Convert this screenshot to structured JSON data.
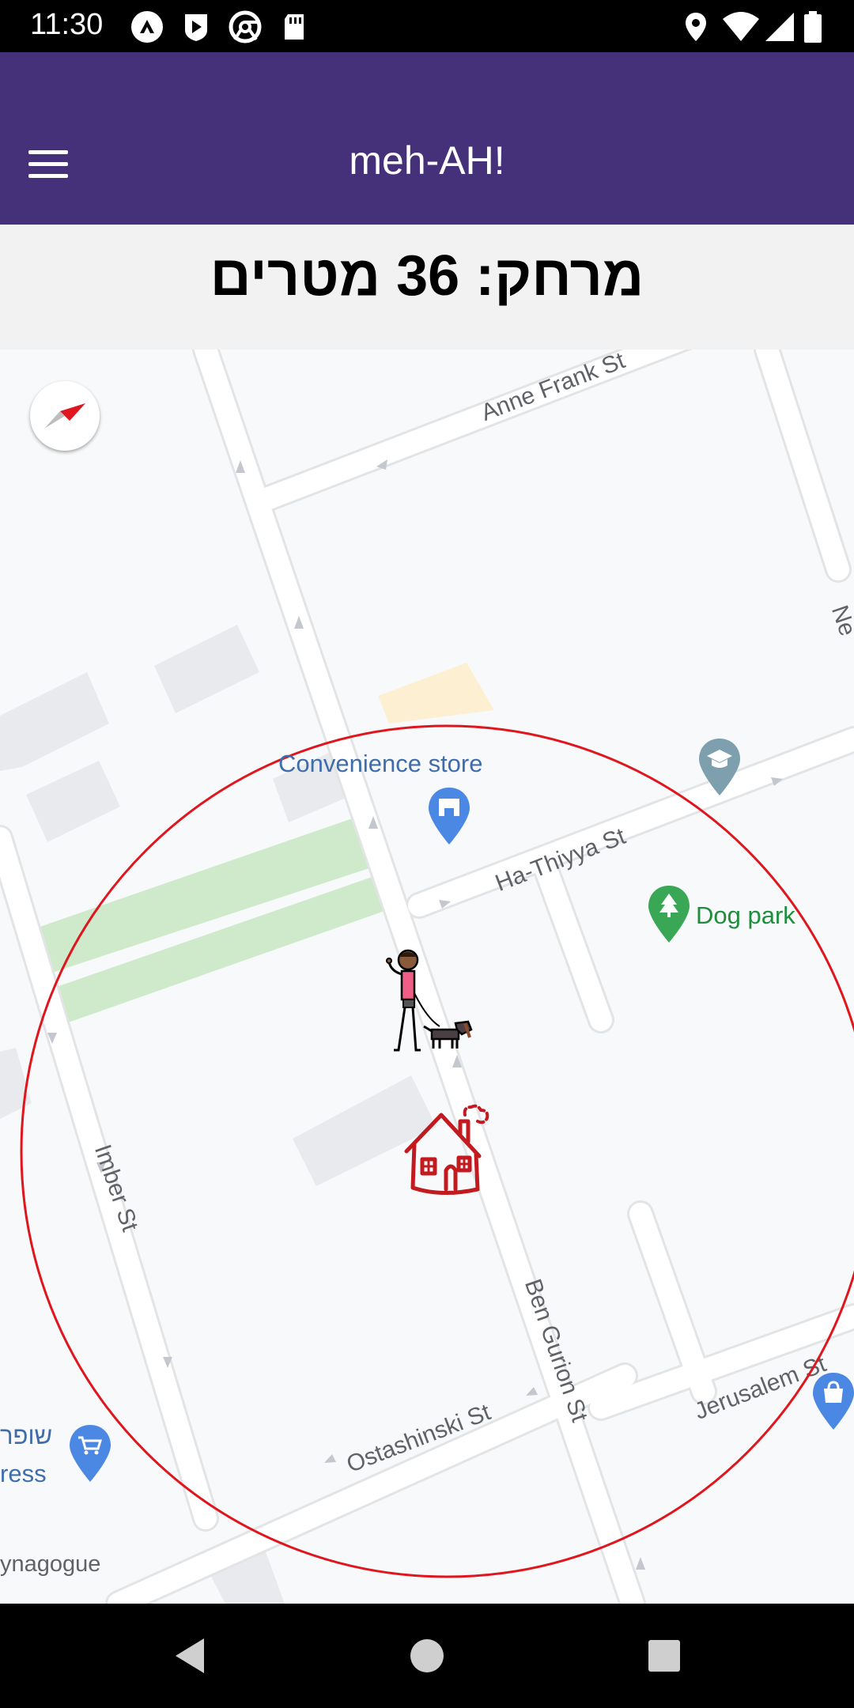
{
  "status_bar": {
    "time": "11:30",
    "left_icons": [
      "nearby-icon",
      "play-icon",
      "chrome-icon",
      "sd-card-icon"
    ],
    "right_icons": [
      "location-icon",
      "wifi-icon",
      "signal-icon",
      "battery-icon"
    ]
  },
  "app_bar": {
    "title": "meh-AH!",
    "menu_icon": "hamburger-menu-icon",
    "background": "#45307a"
  },
  "distance": {
    "text": "מרחק: 36 מטרים"
  },
  "map": {
    "streets": [
      "Anne Frank St",
      "Ha-Thiyya St",
      "Imber St",
      "Ben Gurion St",
      "Ostashinski St",
      "Jerusalem St",
      "Ne"
    ],
    "pois": {
      "convenience_store": "Convenience store",
      "dog_park": "Dog park",
      "supermarket_partial_he": "שופר",
      "supermarket_partial_en": "ress",
      "synagogue_partial": "ynagogue"
    },
    "circle_color": "#e0161e",
    "markers": [
      "person-with-dog-icon",
      "home-icon"
    ],
    "compass_icon": "compass-icon"
  },
  "nav_bar": {
    "icons": [
      "back-icon",
      "home-nav-icon",
      "recents-icon"
    ]
  }
}
